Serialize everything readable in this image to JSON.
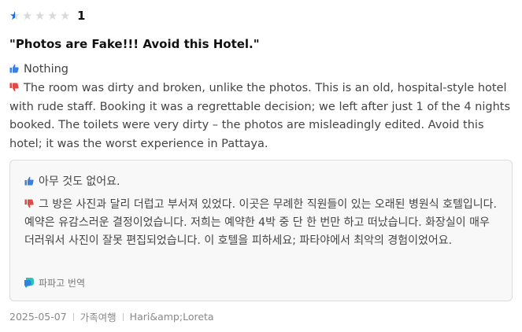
{
  "review": {
    "rating": {
      "value": "1",
      "fill_fractions": [
        0.5,
        0,
        0,
        0,
        0
      ],
      "star_color": "#1a6ad4",
      "empty_color": "#d9d9d9"
    },
    "title": "\"Photos are Fake!!! Avoid this Hotel.\"",
    "pros": {
      "icon": "thumbs-up-icon",
      "text": "Nothing"
    },
    "cons": {
      "icon": "thumbs-down-icon",
      "text": "The room was dirty and broken, unlike the photos. This is an old, hospital-style hotel with rude staff. Booking it was a regrettable decision; we left after just 1 of the 4 nights booked. The toilets were very dirty – the photos are misleadingly edited. Avoid this hotel; it was the worst experience in Pattaya."
    },
    "translation": {
      "pros_text": "아무 것도 없어요.",
      "cons_text": "그 방은 사진과 달리 더럽고 부서져 있었다. 이곳은 무례한 직원들이 있는 오래된 병원식 호텔입니다. 예약은 유감스러운 결정이었습니다. 저희는 예약한 4박 중 단 한 번만 하고 떠났습니다. 화장실이 매우 더러워서 사진이 잘못 편집되었습니다. 이 호텔을 피하세요; 파타야에서 최악의 경험이었어요.",
      "provider_icon": "papago-icon",
      "provider_label": "파파고 번역"
    },
    "meta": {
      "date": "2025-05-07",
      "traveler_type": "가족여행",
      "reviewer": "Hari&amp;Loreta"
    },
    "colors": {
      "thumbs_up": "#3d7fdc",
      "thumbs_down": "#e04a43"
    }
  }
}
